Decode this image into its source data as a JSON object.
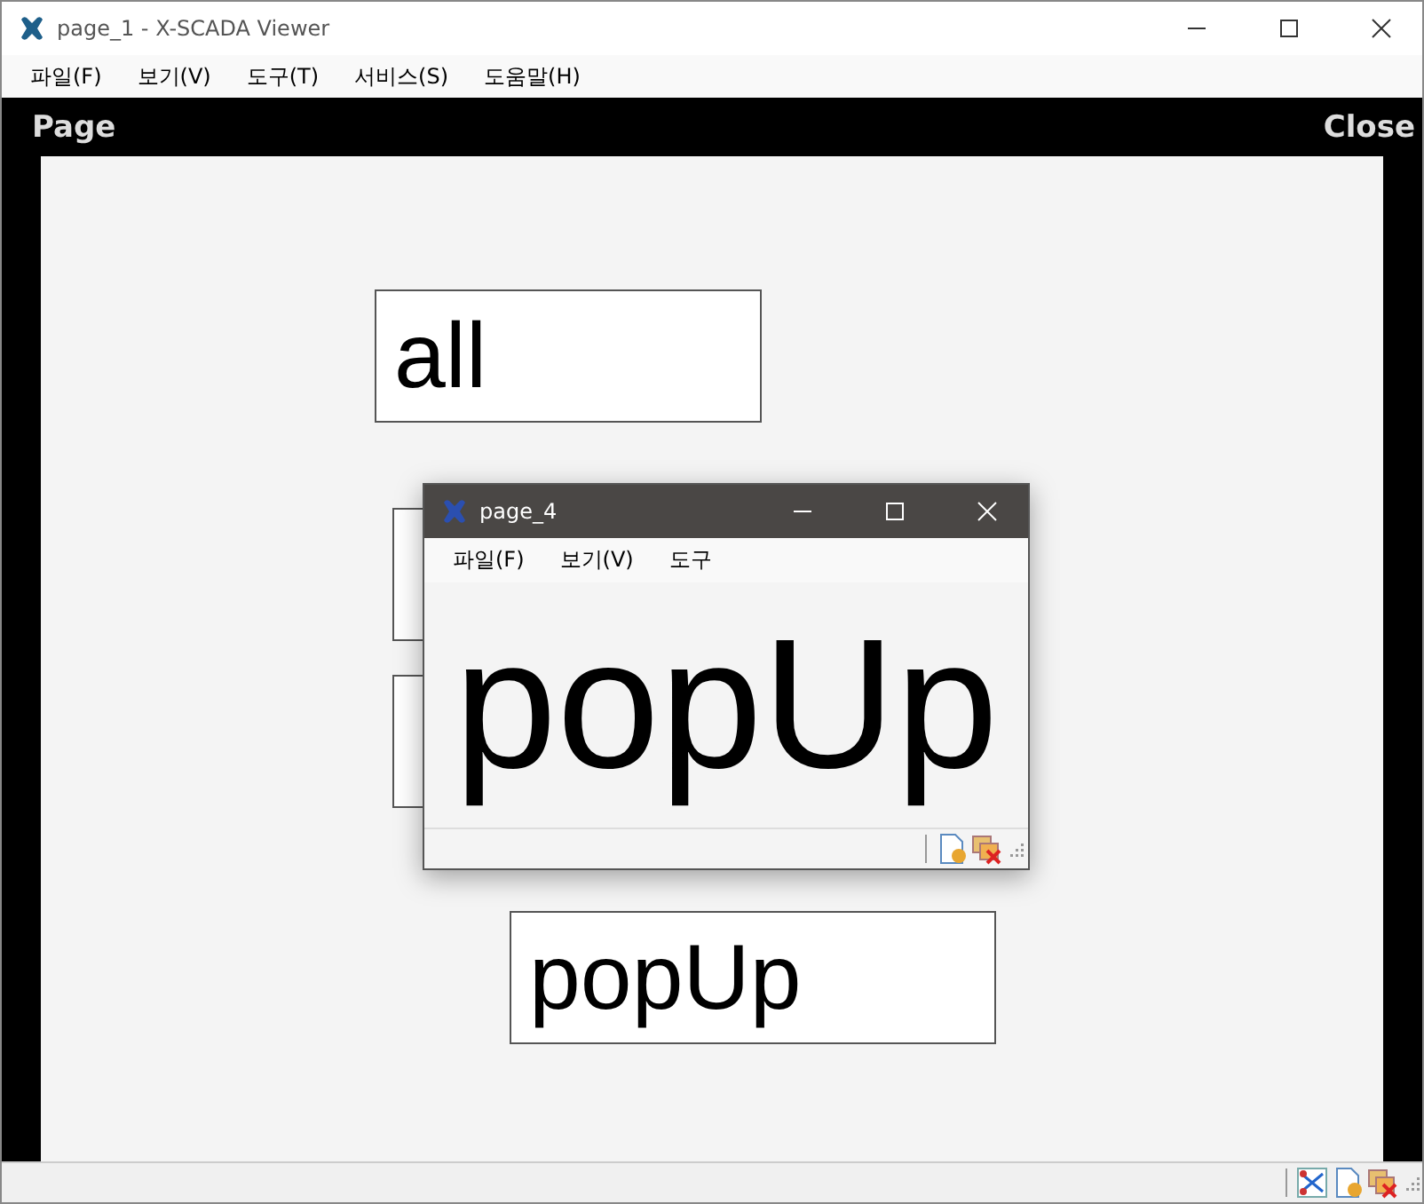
{
  "window": {
    "title": "page_1 - X-SCADA Viewer"
  },
  "menu": [
    "파일(F)",
    "보기(V)",
    "도구(T)",
    "서비스(S)",
    "도움말(H)"
  ],
  "header": {
    "title": "Page",
    "close": "Close"
  },
  "canvas": {
    "boxes": [
      {
        "kind": "label",
        "text": "all"
      },
      {
        "kind": "blank"
      },
      {
        "kind": "blank"
      },
      {
        "kind": "label",
        "text": "popUp"
      }
    ]
  },
  "popup": {
    "title": "page_4",
    "menu": [
      "파일(F)",
      "보기(V)",
      "도구"
    ],
    "text": "popUp"
  }
}
